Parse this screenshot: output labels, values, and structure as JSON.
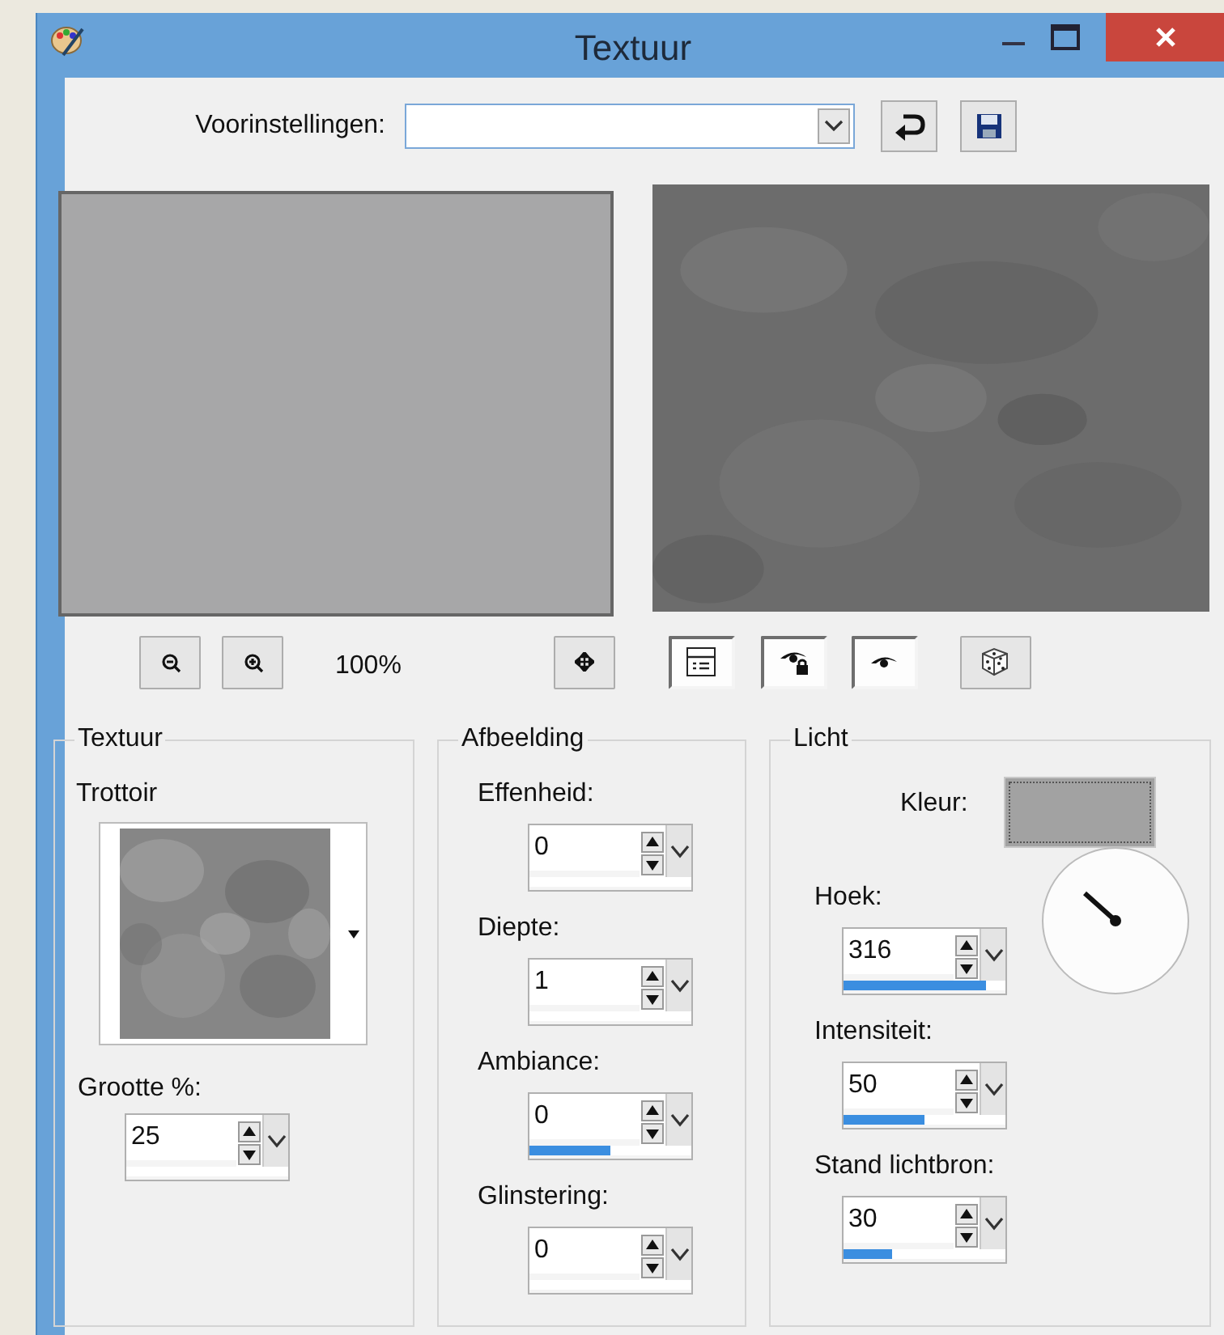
{
  "window": {
    "title": "Textuur"
  },
  "presets": {
    "label": "Voorinstellingen:"
  },
  "zoom_text": "100%",
  "toolbar": [
    {
      "kind": "zoom_out",
      "pressed": false
    },
    {
      "kind": "zoom_in",
      "pressed": false
    },
    {
      "kind": "move",
      "pressed": false
    },
    {
      "kind": "layout",
      "pressed": true
    },
    {
      "kind": "eye_lock",
      "pressed": true
    },
    {
      "kind": "eye",
      "pressed": true
    },
    {
      "kind": "dice",
      "pressed": false
    }
  ],
  "texture_group": {
    "legend": "Textuur",
    "texture_name": "Trottoir",
    "size_label": "Grootte %:",
    "size": {
      "value": "25"
    }
  },
  "image_group": {
    "legend": "Afbeelding",
    "fields": [
      {
        "label": "Effenheid:",
        "value": "0"
      },
      {
        "label": "Diepte:",
        "value": "1"
      },
      {
        "label": "Ambiance:",
        "value": "0",
        "level": 0.5
      },
      {
        "label": "Glinstering:",
        "value": "0"
      }
    ]
  },
  "light_group": {
    "legend": "Licht",
    "color_label": "Kleur:",
    "color": "#a2a2a2",
    "fields": [
      {
        "label": "Hoek:",
        "value": "316",
        "level": 0.88
      },
      {
        "label": "Intensiteit:",
        "value": "50",
        "level": 0.5
      },
      {
        "label": "Stand lichtbron:",
        "value": "30",
        "level": 0.3
      }
    ]
  }
}
